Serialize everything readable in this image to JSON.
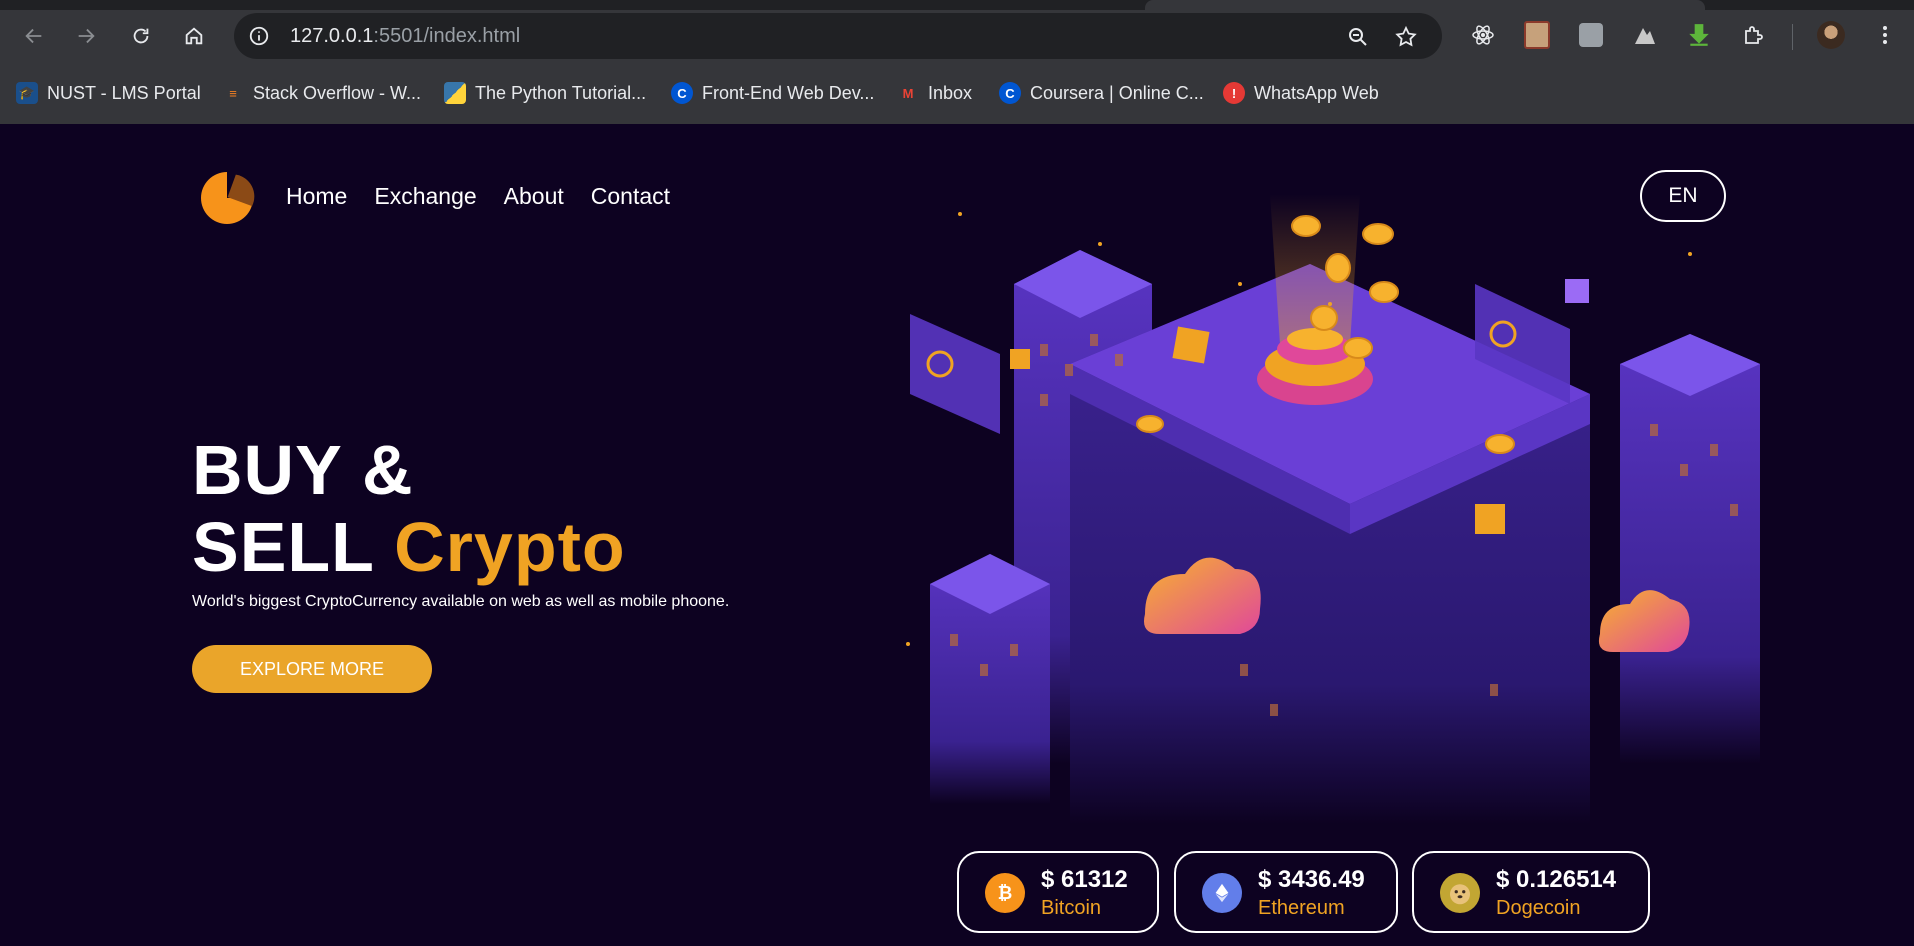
{
  "browser": {
    "url_host": "127.0.0.1",
    "url_rest": ":5501/index.html",
    "bookmarks": [
      {
        "label": "NUST - LMS Portal",
        "icon": "graduation-cap-icon",
        "color": "#1a4f8b"
      },
      {
        "label": "Stack Overflow - W...",
        "icon": "stackoverflow-icon",
        "color": "#f48024"
      },
      {
        "label": "The Python Tutorial...",
        "icon": "python-icon",
        "color": "#3776ab"
      },
      {
        "label": "Front-End Web Dev...",
        "icon": "coursera-icon",
        "color": "#0056d2"
      },
      {
        "label": "Inbox",
        "icon": "gmail-icon",
        "color": "#ea4335"
      },
      {
        "label": "Coursera | Online C...",
        "icon": "coursera-icon",
        "color": "#0056d2"
      },
      {
        "label": "WhatsApp Web",
        "icon": "whatsapp-icon",
        "color": "#e53935"
      }
    ]
  },
  "nav": {
    "links": [
      "Home",
      "Exchange",
      "About",
      "Contact"
    ],
    "lang": "EN"
  },
  "hero": {
    "title_line1": "BUY &",
    "title_line2": "SELL",
    "title_accent": "Crypto",
    "subtitle": "World's biggest CryptoCurrency available on web as well as mobile phoone.",
    "cta": "EXPLORE MORE"
  },
  "coins": [
    {
      "price": "$ 61312",
      "name": "Bitcoin",
      "icon": "bitcoin-icon",
      "color": "#f7931a"
    },
    {
      "price": "$ 3436.49",
      "name": "Ethereum",
      "icon": "ethereum-icon",
      "color": "#627eea"
    },
    {
      "price": "$ 0.126514",
      "name": "Dogecoin",
      "icon": "dogecoin-icon",
      "color": "#c2a633"
    }
  ],
  "colors": {
    "accent": "#f0a323",
    "background": "#0d0221",
    "purple": "#6a3fd6"
  }
}
